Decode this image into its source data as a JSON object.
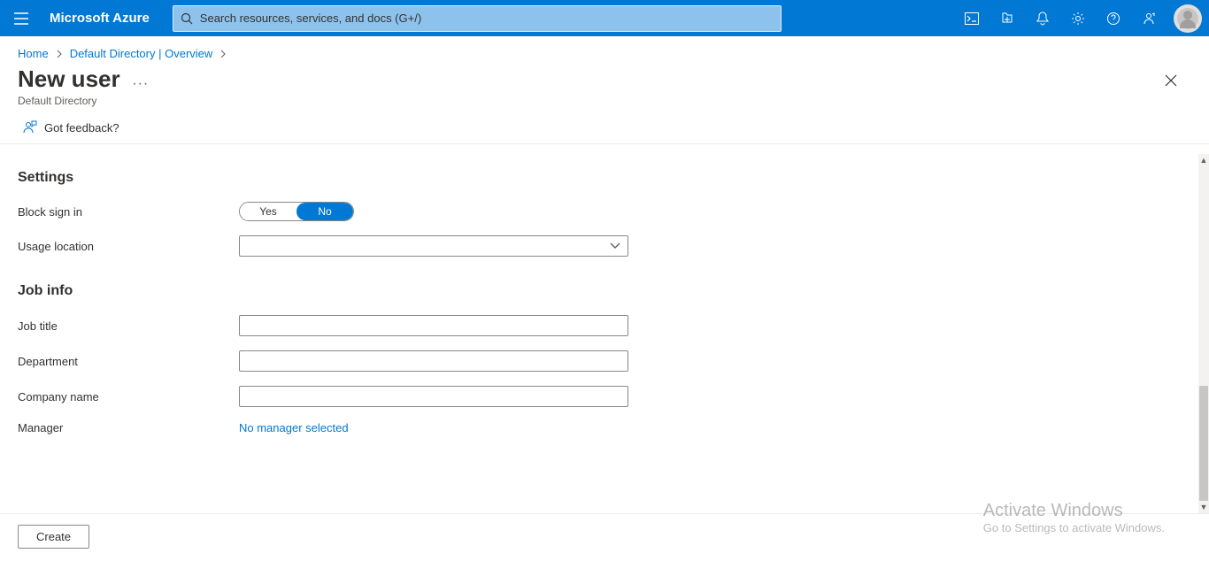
{
  "brand": "Microsoft Azure",
  "search": {
    "placeholder": "Search resources, services, and docs (G+/)"
  },
  "breadcrumb": {
    "items": [
      "Home",
      "Default Directory | Overview"
    ]
  },
  "page": {
    "title": "New user",
    "subtitle": "Default Directory",
    "more": "···"
  },
  "toolbar": {
    "feedback": "Got feedback?"
  },
  "sections": {
    "settings": {
      "title": "Settings",
      "blockSignIn": {
        "label": "Block sign in",
        "yes": "Yes",
        "no": "No"
      },
      "usageLocation": {
        "label": "Usage location",
        "value": ""
      }
    },
    "jobInfo": {
      "title": "Job info",
      "jobTitle": {
        "label": "Job title",
        "value": ""
      },
      "department": {
        "label": "Department",
        "value": ""
      },
      "companyName": {
        "label": "Company name",
        "value": ""
      },
      "manager": {
        "label": "Manager",
        "link": "No manager selected"
      }
    }
  },
  "footer": {
    "create": "Create"
  },
  "overlay": {
    "heading": "Activate Windows",
    "sub": "Go to Settings to activate Windows."
  }
}
